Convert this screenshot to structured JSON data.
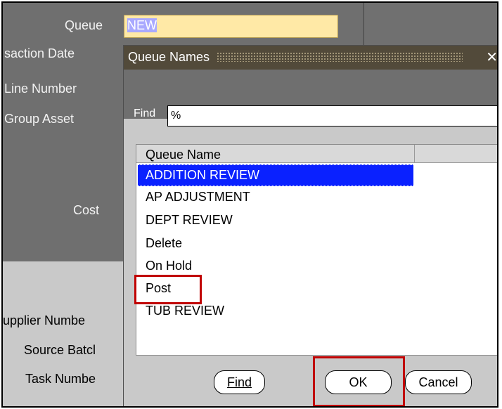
{
  "form": {
    "labels": {
      "queue": "Queue",
      "transaction_date": "saction Date",
      "line_number": "Line Number",
      "group_asset": "Group Asset",
      "cost": "Cost",
      "supplier_number": "upplier Numbe",
      "source_batch": "Source Batcl",
      "task_number": "Task Numbe"
    },
    "queue_value": "NEW"
  },
  "dialog": {
    "title": "Queue Names",
    "find_label": "Find",
    "find_value": "%",
    "column_header": "Queue Name",
    "items": [
      {
        "label": "ADDITION REVIEW",
        "selected": true
      },
      {
        "label": "AP ADJUSTMENT",
        "selected": false
      },
      {
        "label": "DEPT REVIEW",
        "selected": false
      },
      {
        "label": "Delete",
        "selected": false
      },
      {
        "label": "On Hold",
        "selected": false
      },
      {
        "label": "Post",
        "selected": false
      },
      {
        "label": "TUB REVIEW",
        "selected": false
      }
    ],
    "buttons": {
      "find": "Find",
      "ok": "OK",
      "cancel": "Cancel"
    }
  },
  "colors": {
    "highlight_box": "#c00000",
    "selection": "#0a21ff",
    "title_bar": "#524a3a"
  },
  "icons": {
    "close": "close-icon"
  }
}
